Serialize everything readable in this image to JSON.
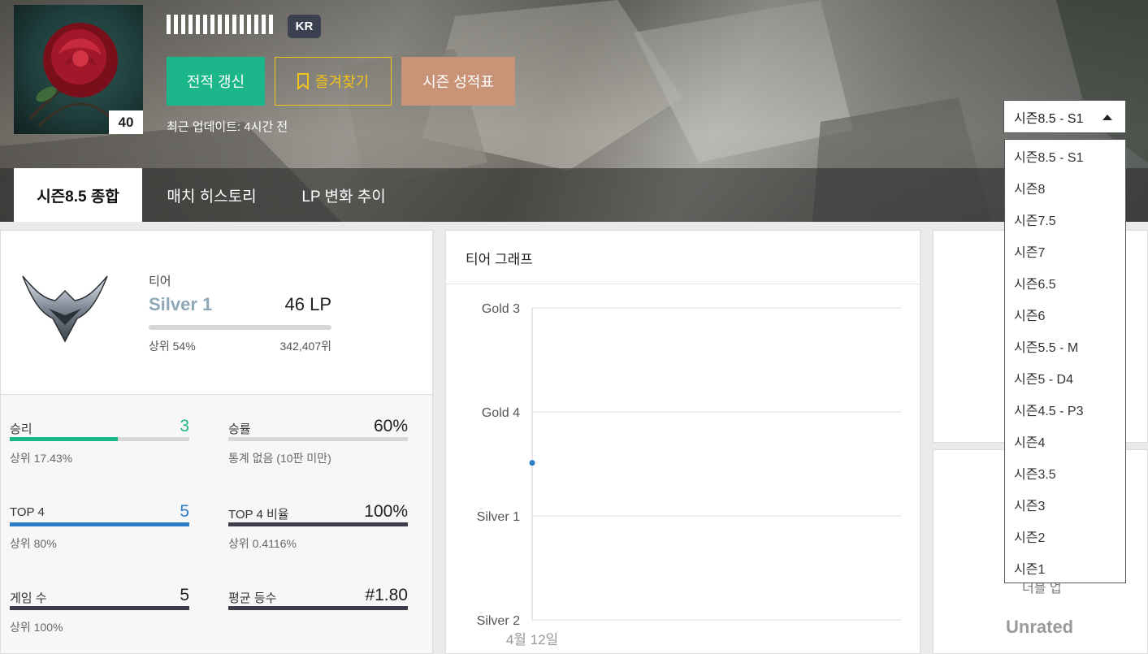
{
  "profile": {
    "level": "40",
    "region": "KR",
    "last_updated": "최근 업데이트: 4시간 전"
  },
  "actions": {
    "renew_label": "전적 갱신",
    "favorite_label": "즐겨찾기",
    "season_report_label": "시즌 성적표"
  },
  "tabs": [
    {
      "label": "시즌8.5 종합"
    },
    {
      "label": "매치 히스토리"
    },
    {
      "label": "LP 변화 추이"
    }
  ],
  "season_select": {
    "selected": "시즌8.5 - S1",
    "options": [
      "시즌8.5 - S1",
      "시즌8",
      "시즌7.5",
      "시즌7",
      "시즌6.5",
      "시즌6",
      "시즌5.5 - M",
      "시즌5 - D4",
      "시즌4.5 - P3",
      "시즌4",
      "시즌3.5",
      "시즌3",
      "시즌2",
      "시즌1"
    ]
  },
  "tier": {
    "label": "티어",
    "name": "Silver 1",
    "lp": "46 LP",
    "top_percent": "상위 54%",
    "rank": "342,407위"
  },
  "stats": [
    {
      "label": "승리",
      "value": "3",
      "sub": "상위 17.43%",
      "fill": 0.6,
      "color": "#1bb78a"
    },
    {
      "label": "승률",
      "value": "60%",
      "sub": "통계 없음 (10판 미만)",
      "fill": 0,
      "color": "#3b3d4a"
    },
    {
      "label": "TOP 4",
      "value": "5",
      "sub": "상위 80%",
      "fill": 1,
      "color": "#2d7cc6"
    },
    {
      "label": "TOP 4 비율",
      "value": "100%",
      "sub": "상위 0.4116%",
      "fill": 1,
      "color": "#3b3d4a"
    },
    {
      "label": "게임 수",
      "value": "5",
      "sub": "상위 100%",
      "fill": 1,
      "color": "#3b3d4a"
    },
    {
      "label": "평균 등수",
      "value": "#1.80",
      "sub": "",
      "fill": 1,
      "color": "#3b3d4a"
    }
  ],
  "tier_graph": {
    "title": "티어 그래프",
    "y_ticks": [
      "Gold 3",
      "Gold 4",
      "Silver 1",
      "Silver 2"
    ],
    "x_ticks": [
      "4월 12일"
    ],
    "point": {
      "x": "4월 12일",
      "y_index": 2.46
    },
    "point_color": "#2d7cc6"
  },
  "chart_data": {
    "type": "line",
    "title": "티어 그래프",
    "x": [
      "4월 12일"
    ],
    "categories_y": [
      "Silver 2",
      "Silver 1",
      "Gold 4",
      "Gold 3"
    ],
    "series": [
      {
        "values": [
          "Silver 1 (46 LP)"
        ]
      }
    ],
    "grid": true
  },
  "right_panel": {
    "partial_label": "더블 업",
    "rating": "Unrated"
  }
}
